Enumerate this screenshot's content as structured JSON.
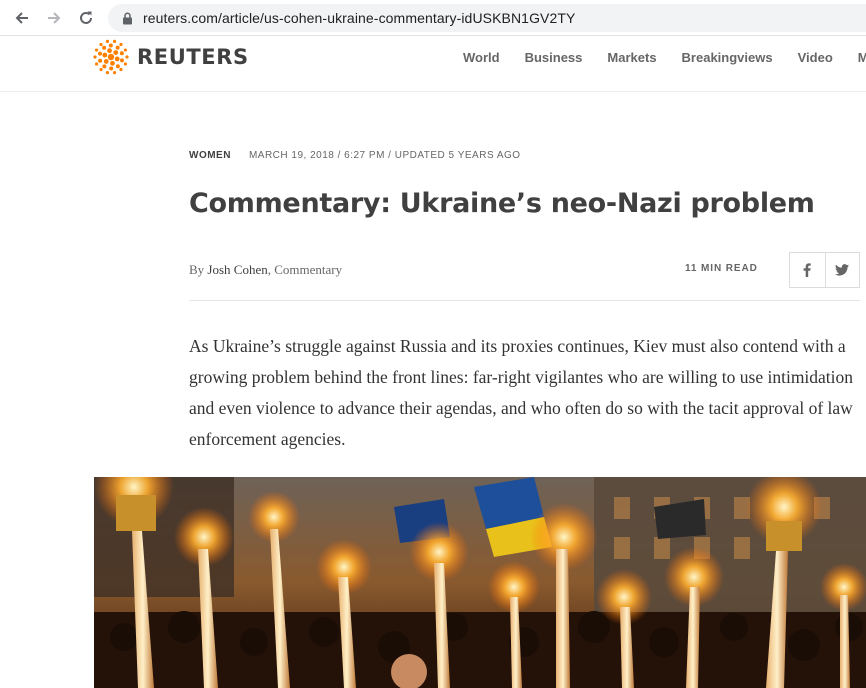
{
  "browser": {
    "url": "reuters.com/article/us-cohen-ukraine-commentary-idUSKBN1GV2TY"
  },
  "site": {
    "logo_text": "REUTERS",
    "nav": [
      "World",
      "Business",
      "Markets",
      "Breakingviews",
      "Video",
      "M"
    ]
  },
  "article": {
    "section": "WOMEN",
    "dateline": "MARCH 19, 2018 / 6:27 PM / UPDATED 5 YEARS AGO",
    "headline": "Commentary: Ukraine’s neo-Nazi problem",
    "byline_prefix": "By ",
    "author": "Josh Cohen",
    "byline_suffix": ", Commentary",
    "read_time": "11 MIN READ",
    "lead": "As Ukraine’s struggle against Russia and its proxies continues, Kiev must also contend with a growing problem behind the front lines: far-right vigilantes who are willing to use intimidation and even violence to advance their agendas, and who often do so with the tacit approval of law enforcement agencies."
  },
  "icons": {
    "back": "arrow-left-icon",
    "forward": "arrow-right-icon",
    "reload": "reload-icon",
    "lock": "lock-icon",
    "facebook": "facebook-icon",
    "twitter": "twitter-icon"
  },
  "colors": {
    "brand_orange": "#ff8000",
    "headline": "#404040",
    "meta": "#666666"
  }
}
